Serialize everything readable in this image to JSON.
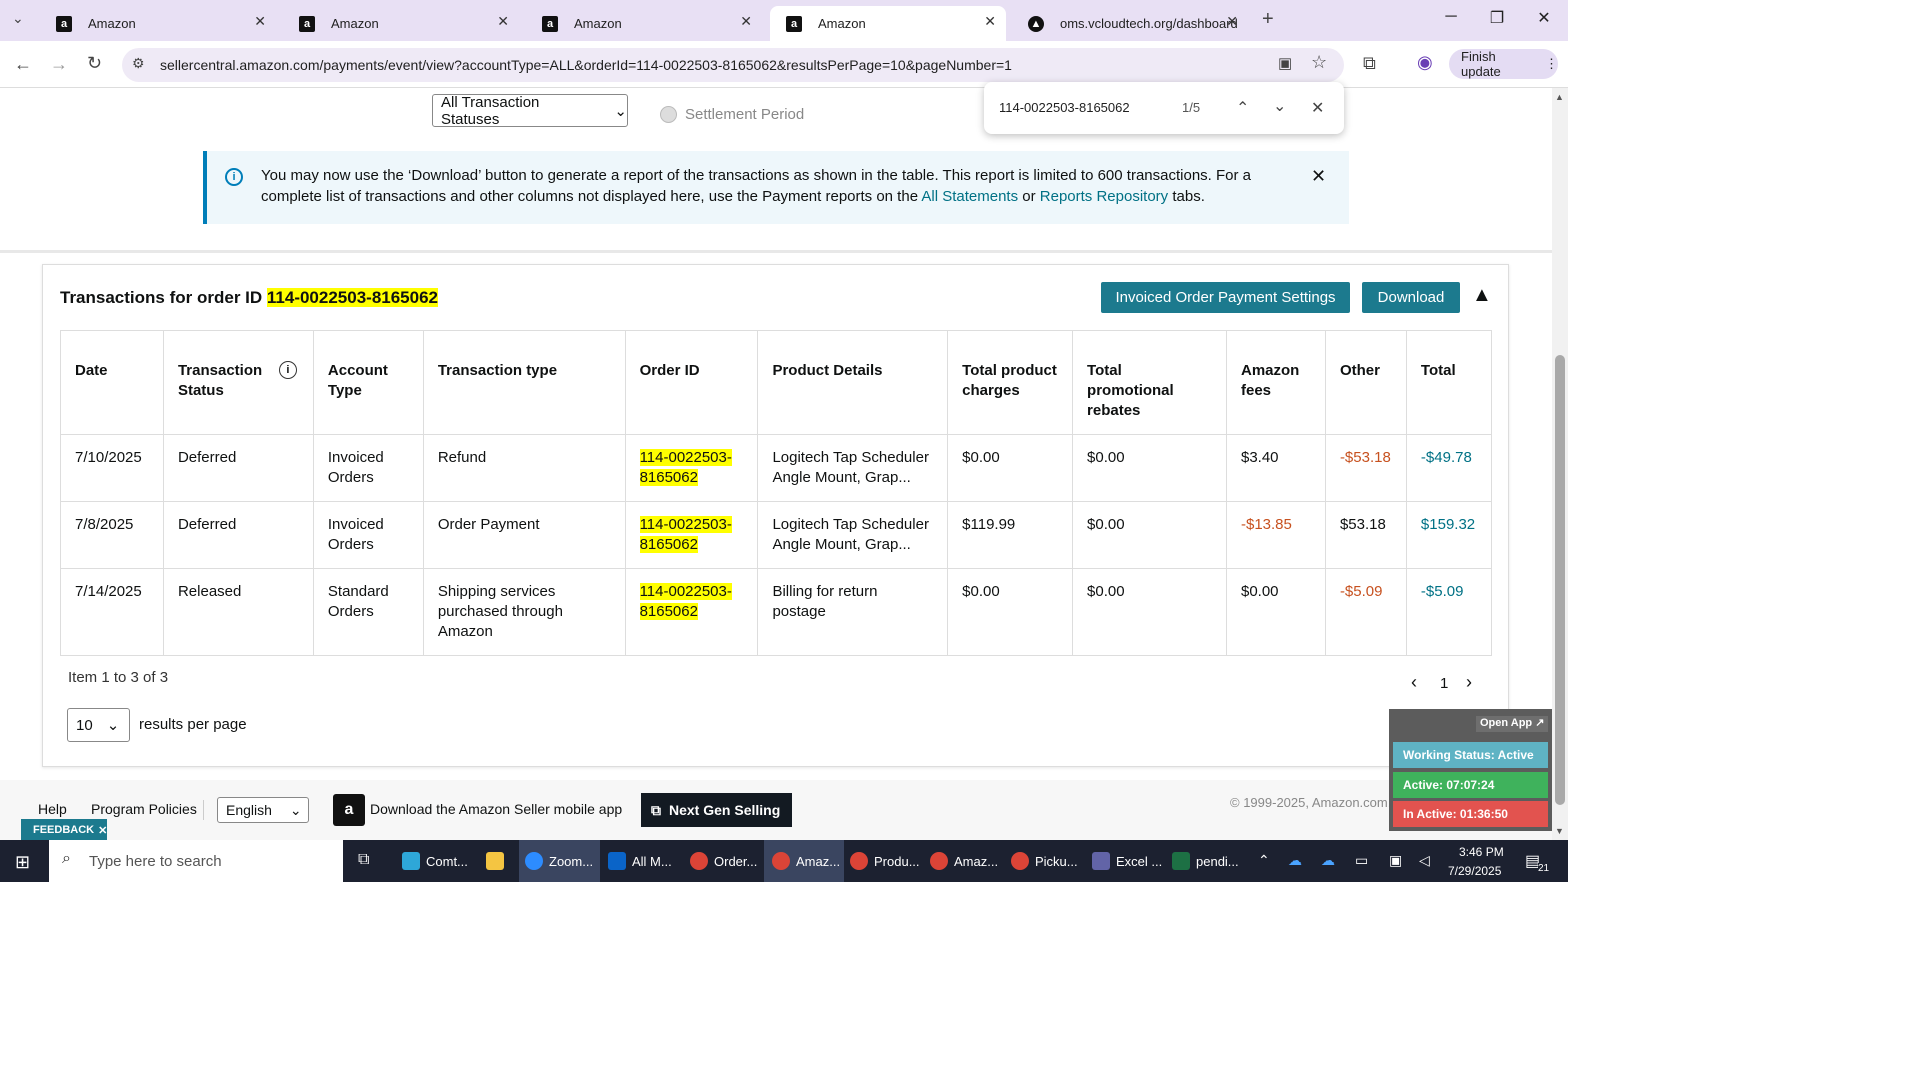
{
  "browser": {
    "tabs": [
      {
        "title": "Amazon",
        "active": false
      },
      {
        "title": "Amazon",
        "active": false
      },
      {
        "title": "Amazon",
        "active": false
      },
      {
        "title": "Amazon",
        "active": true
      },
      {
        "title": "oms.vcloudtech.org/dashboard",
        "active": false
      }
    ],
    "url": "sellercentral.amazon.com/payments/event/view?accountType=ALL&orderId=114-0022503-8165062&resultsPerPage=10&pageNumber=1",
    "finish_update": "Finish update"
  },
  "find_bar": {
    "query": "114-0022503-8165062",
    "count": "1/5"
  },
  "filters": {
    "status_select": "All Transaction Statuses",
    "settlement_radio": "Settlement Period"
  },
  "banner": {
    "text_before": "You may now use the ‘Download’ button to generate a report of the transactions as shown in the table. This report is limited to 600 transactions. For a complete list of transactions and other columns not displayed here, use the Payment reports on the ",
    "link1": "All Statements",
    "middle": " or ",
    "link2": "Reports Repository",
    "after": " tabs."
  },
  "card": {
    "title_prefix": "Transactions for order ID ",
    "order_id": "114-0022503-8165062",
    "settings_button": "Invoiced Order Payment Settings",
    "download_button": "Download"
  },
  "table": {
    "headers": [
      "Date",
      "Transaction Status",
      "Account Type",
      "Transaction type",
      "Order ID",
      "Product Details",
      "Total product charges",
      "Total promotional rebates",
      "Amazon fees",
      "Other",
      "Total"
    ],
    "rows": [
      {
        "date": "7/10/2025",
        "status": "Deferred",
        "account": "Invoiced Orders",
        "type": "Refund",
        "order_a": "114-0022503-",
        "order_b": "8165062",
        "product": "Logitech Tap Scheduler Angle Mount, Grap...",
        "charges": "$0.00",
        "rebates": "$0.00",
        "fees": "$3.40",
        "other": "-$53.18",
        "total": "-$49.78"
      },
      {
        "date": "7/8/2025",
        "status": "Deferred",
        "account": "Invoiced Orders",
        "type": "Order Payment",
        "order_a": "114-0022503-",
        "order_b": "8165062",
        "product": "Logitech Tap Scheduler Angle Mount, Grap...",
        "charges": "$119.99",
        "rebates": "$0.00",
        "fees": "-$13.85",
        "other": "$53.18",
        "total": "$159.32"
      },
      {
        "date": "7/14/2025",
        "status": "Released",
        "account": "Standard Orders",
        "type": "Shipping services purchased through Amazon",
        "order_a": "114-0022503-",
        "order_b": "8165062",
        "product": "Billing for return postage",
        "charges": "$0.00",
        "rebates": "$0.00",
        "fees": "$0.00",
        "other": "-$5.09",
        "total": "-$5.09"
      }
    ]
  },
  "pagination": {
    "summary": "Item 1 to 3 of 3",
    "page": "1",
    "per_page_value": "10",
    "per_page_label": "results per page"
  },
  "footer": {
    "help": "Help",
    "policies": "Program Policies",
    "language": "English",
    "app_text": "Download the Amazon Seller mobile app",
    "next_gen": "Next Gen Selling",
    "copyright": "© 1999-2025, Amazon.com, Inc. or its affiliates",
    "feedback": "FEEDBACK"
  },
  "widget": {
    "open_app": "Open App ↗",
    "working": "Working Status: Active",
    "active": "Active: 07:07:24",
    "inactive": "In Active: 01:36:50"
  },
  "taskbar": {
    "search": "Type here to search",
    "items": [
      "Comt...",
      "",
      "Zoom...",
      "All M...",
      "Order...",
      "Amaz...",
      "Produ...",
      "Amaz...",
      "Picku...",
      "Excel ...",
      "pendi..."
    ],
    "time": "3:46 PM",
    "date": "7/29/2025",
    "notif": "21"
  }
}
